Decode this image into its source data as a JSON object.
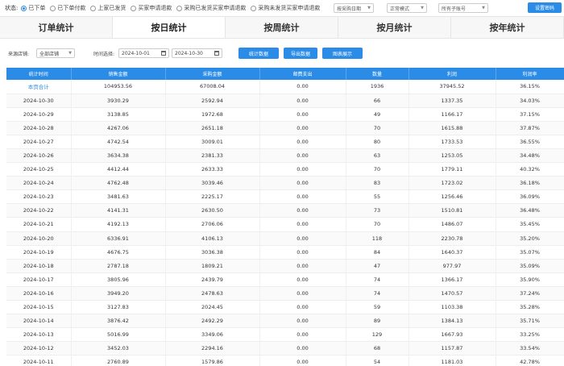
{
  "status": {
    "label": "状态:",
    "options": [
      {
        "label": "已下单",
        "checked": true
      },
      {
        "label": "已下单付款",
        "checked": false
      },
      {
        "label": "上家已发货",
        "checked": false
      },
      {
        "label": "买家申请退款",
        "checked": false
      },
      {
        "label": "采购已发货买家申请退款",
        "checked": false
      },
      {
        "label": "采购未发货买家申请退款",
        "checked": false
      }
    ],
    "date_select": "按采购日期",
    "mode_select": "正常模式",
    "account_select": "所有子账号",
    "settings_button": "设置密码"
  },
  "tabs": [
    {
      "label": "订单统计",
      "active": false
    },
    {
      "label": "按日统计",
      "active": true
    },
    {
      "label": "按周统计",
      "active": false
    },
    {
      "label": "按月统计",
      "active": false
    },
    {
      "label": "按年统计",
      "active": false
    }
  ],
  "filters": {
    "shop_label": "来源店铺:",
    "shop_value": "全部店铺",
    "time_label": "时间选择:",
    "date_start": "2024-10-01",
    "date_end": "2024-10-30",
    "btn_stats": "统计数据",
    "btn_export": "导出数据",
    "btn_chart": "图表展示"
  },
  "table": {
    "headers": [
      "统计时间",
      "销售金额",
      "采购金额",
      "邮费支出",
      "数量",
      "利润",
      "利润率"
    ],
    "rows": [
      [
        "本页合计",
        "104953.56",
        "67008.04",
        "0.00",
        "1936",
        "37945.52",
        "36.15%"
      ],
      [
        "2024-10-30",
        "3930.29",
        "2592.94",
        "0.00",
        "66",
        "1337.35",
        "34.03%"
      ],
      [
        "2024-10-29",
        "3138.85",
        "1972.68",
        "0.00",
        "49",
        "1166.17",
        "37.15%"
      ],
      [
        "2024-10-28",
        "4267.06",
        "2651.18",
        "0.00",
        "70",
        "1615.88",
        "37.87%"
      ],
      [
        "2024-10-27",
        "4742.54",
        "3009.01",
        "0.00",
        "80",
        "1733.53",
        "36.55%"
      ],
      [
        "2024-10-26",
        "3634.38",
        "2381.33",
        "0.00",
        "63",
        "1253.05",
        "34.48%"
      ],
      [
        "2024-10-25",
        "4412.44",
        "2633.33",
        "0.00",
        "70",
        "1779.11",
        "40.32%"
      ],
      [
        "2024-10-24",
        "4762.48",
        "3039.46",
        "0.00",
        "83",
        "1723.02",
        "36.18%"
      ],
      [
        "2024-10-23",
        "3481.63",
        "2225.17",
        "0.00",
        "55",
        "1256.46",
        "36.09%"
      ],
      [
        "2024-10-22",
        "4141.31",
        "2630.50",
        "0.00",
        "73",
        "1510.81",
        "36.48%"
      ],
      [
        "2024-10-21",
        "4192.13",
        "2706.06",
        "0.00",
        "70",
        "1486.07",
        "35.45%"
      ],
      [
        "2024-10-20",
        "6336.91",
        "4106.13",
        "0.00",
        "118",
        "2230.78",
        "35.20%"
      ],
      [
        "2024-10-19",
        "4676.75",
        "3036.38",
        "0.00",
        "84",
        "1640.37",
        "35.07%"
      ],
      [
        "2024-10-18",
        "2787.18",
        "1809.21",
        "0.00",
        "47",
        "977.97",
        "35.09%"
      ],
      [
        "2024-10-17",
        "3805.96",
        "2439.79",
        "0.00",
        "74",
        "1366.17",
        "35.90%"
      ],
      [
        "2024-10-16",
        "3949.20",
        "2478.63",
        "0.00",
        "74",
        "1470.57",
        "37.24%"
      ],
      [
        "2024-10-15",
        "3127.83",
        "2024.45",
        "0.00",
        "59",
        "1103.38",
        "35.28%"
      ],
      [
        "2024-10-14",
        "3876.42",
        "2492.29",
        "0.00",
        "89",
        "1384.13",
        "35.71%"
      ],
      [
        "2024-10-13",
        "5016.99",
        "3349.06",
        "0.00",
        "129",
        "1667.93",
        "33.25%"
      ],
      [
        "2024-10-12",
        "3452.03",
        "2294.16",
        "0.00",
        "68",
        "1157.87",
        "33.54%"
      ],
      [
        "2024-10-11",
        "2760.89",
        "1579.86",
        "0.00",
        "54",
        "1181.03",
        "42.78%"
      ]
    ]
  }
}
